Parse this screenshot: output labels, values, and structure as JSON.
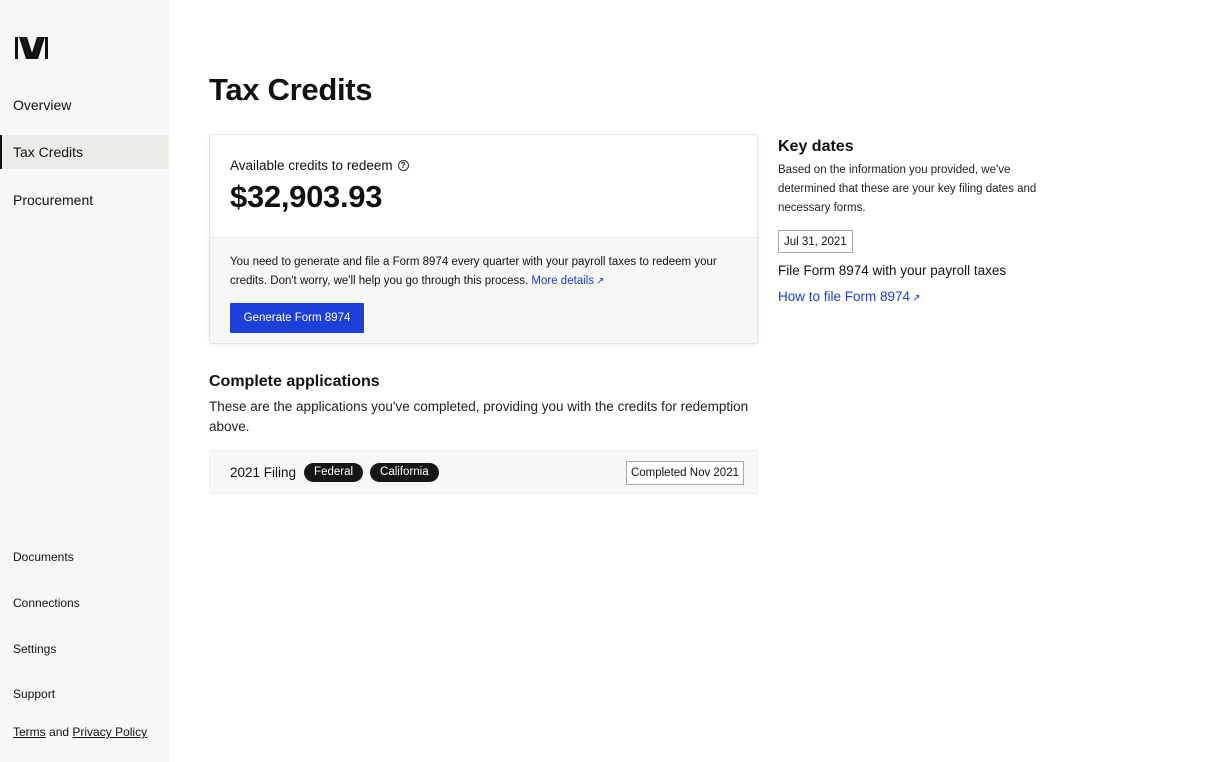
{
  "sidebar": {
    "logo_icon": "m-logo-icon",
    "nav": [
      {
        "label": "Overview",
        "active": false
      },
      {
        "label": "Tax Credits",
        "active": true
      },
      {
        "label": "Procurement",
        "active": false
      }
    ],
    "secondary": [
      {
        "label": "Documents"
      },
      {
        "label": "Connections"
      },
      {
        "label": "Settings"
      },
      {
        "label": "Support"
      }
    ],
    "legal": {
      "terms": "Terms",
      "and": "and",
      "privacy": "Privacy Policy"
    }
  },
  "main": {
    "title": "Tax Credits",
    "credits_card": {
      "label": "Available credits to redeem",
      "help_icon": "question-circle-icon",
      "amount": "$32,903.93",
      "notice": "You need to generate and file a Form 8974 every quarter with your payroll taxes to redeem your credits. Don't worry, we'll help you go through this process.",
      "more_details": "More details",
      "button": "Generate Form 8974"
    },
    "applications": {
      "title": "Complete applications",
      "description": "These are the applications you've completed, providing you with the credits for redemption above.",
      "rows": [
        {
          "name": "2021 Filing",
          "tags": [
            "Federal",
            "California"
          ],
          "status": "Completed Nov 2021"
        }
      ]
    }
  },
  "key_dates": {
    "title": "Key dates",
    "description": "Based on the information you provided, we've determined that these are your key filing dates and necessary forms.",
    "date": "Jul 31, 2021",
    "task": "File Form 8974 with your payroll taxes",
    "link": "How to file Form 8974"
  },
  "colors": {
    "accent": "#1b3fd8",
    "link": "#1a3fd6",
    "sidebar_bg": "#f7f7f5",
    "tag_bg": "#161616"
  }
}
